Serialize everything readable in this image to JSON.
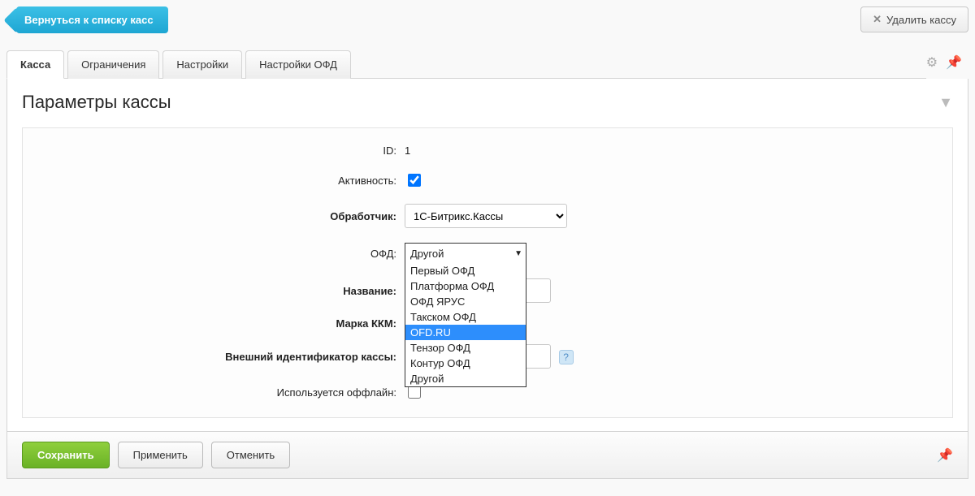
{
  "topbar": {
    "back_label": "Вернуться к списку касс",
    "delete_label": "Удалить кассу"
  },
  "tabs": [
    {
      "label": "Касса",
      "active": true
    },
    {
      "label": "Ограничения",
      "active": false
    },
    {
      "label": "Настройки",
      "active": false
    },
    {
      "label": "Настройки ОФД",
      "active": false
    }
  ],
  "panel": {
    "title": "Параметры кассы"
  },
  "form": {
    "id_label": "ID:",
    "id_value": "1",
    "active_label": "Активность:",
    "active_checked": true,
    "handler_label": "Обработчик:",
    "handler_value": "1С-Битрикс.Кассы",
    "ofd_label": "ОФД:",
    "ofd_selected": "Другой",
    "ofd_options": [
      {
        "label": "Первый ОФД",
        "selected": false
      },
      {
        "label": "Платформа ОФД",
        "selected": false
      },
      {
        "label": "ОФД ЯРУС",
        "selected": false
      },
      {
        "label": "Такском ОФД",
        "selected": false
      },
      {
        "label": "OFD.RU",
        "selected": true
      },
      {
        "label": "Тензор ОФД",
        "selected": false
      },
      {
        "label": "Контур ОФД",
        "selected": false
      },
      {
        "label": "Другой",
        "selected": false
      }
    ],
    "name_label": "Название:",
    "name_value": "",
    "kkm_label": "Марка ККМ:",
    "kkm_value": "",
    "ext_id_label": "Внешний идентификатор кассы:",
    "ext_id_value": "",
    "offline_label": "Используется оффлайн:",
    "offline_checked": false
  },
  "buttons": {
    "save": "Сохранить",
    "apply": "Применить",
    "cancel": "Отменить"
  }
}
